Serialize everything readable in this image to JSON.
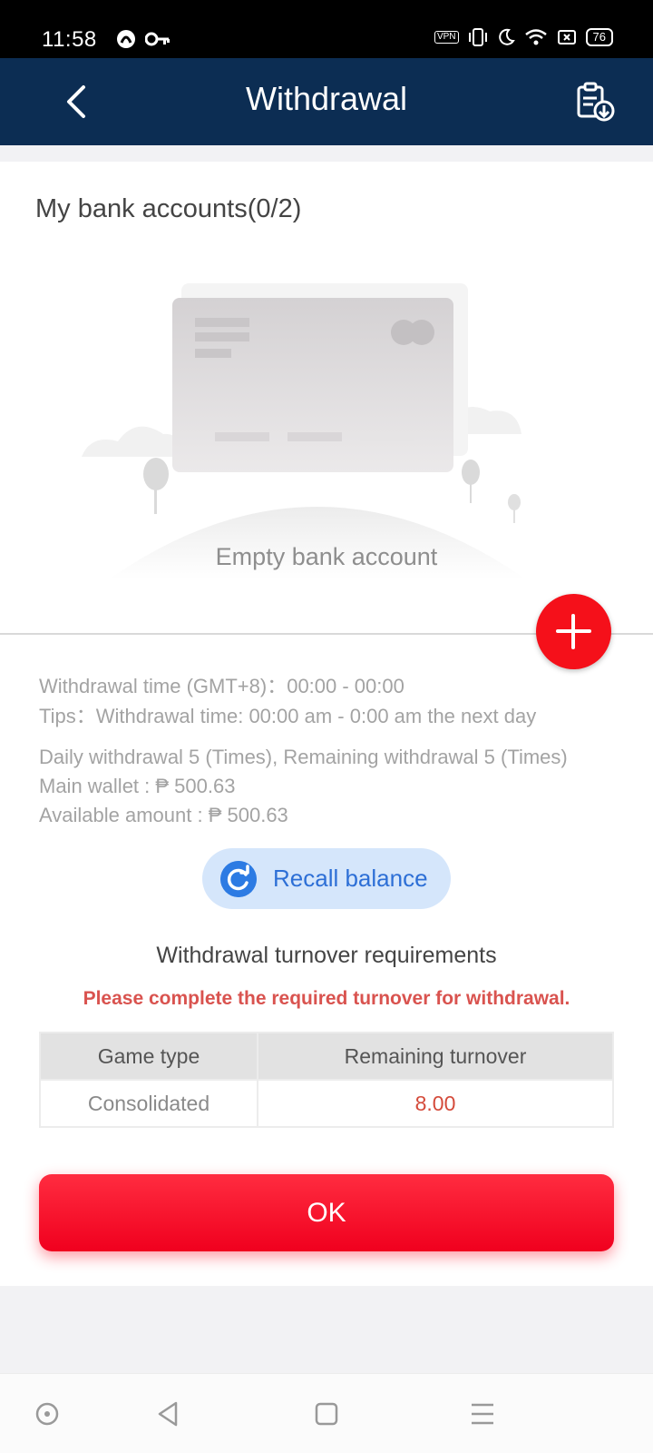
{
  "status_bar": {
    "time": "11:58",
    "vpn_label": "VPN",
    "battery": "76",
    "icons": [
      "notification-app-icon",
      "key-icon",
      "vpn-icon",
      "vibrate-icon",
      "moon-icon",
      "wifi-icon",
      "sim-icon",
      "battery-icon"
    ]
  },
  "header": {
    "title": "Withdrawal",
    "back_icon": "chevron-left-icon",
    "record_icon": "clipboard-download-icon"
  },
  "accounts": {
    "title": "My bank accounts(0/2)",
    "empty_text": "Empty bank account",
    "add_icon": "plus-icon"
  },
  "info": {
    "time_line": "Withdrawal time (GMT+8)：00:00 - 00:00",
    "tips_line": "Tips：Withdrawal time: 00:00 am - 0:00 am the next day",
    "daily_line": "Daily withdrawal 5 (Times), Remaining withdrawal 5 (Times)",
    "wallet_line": "Main wallet : ₱ 500.63",
    "available_line": "Available amount : ₱ 500.63"
  },
  "recall": {
    "label": "Recall balance",
    "icon": "refresh-icon"
  },
  "turnover": {
    "title": "Withdrawal turnover requirements",
    "warning": "Please complete the required turnover for withdrawal.",
    "headers": [
      "Game type",
      "Remaining turnover"
    ],
    "rows": [
      {
        "game_type": "Consolidated",
        "remaining": "8.00"
      }
    ]
  },
  "ok_button": "OK",
  "colors": {
    "header_bg": "#0c2d53",
    "accent_red": "#f5101a",
    "recall_blue": "#2d7be3",
    "warning_red": "#d9534f"
  },
  "navbar": {
    "icons": [
      "home-circle-icon",
      "back-triangle-icon",
      "recents-square-icon",
      "menu-lines-icon"
    ]
  }
}
